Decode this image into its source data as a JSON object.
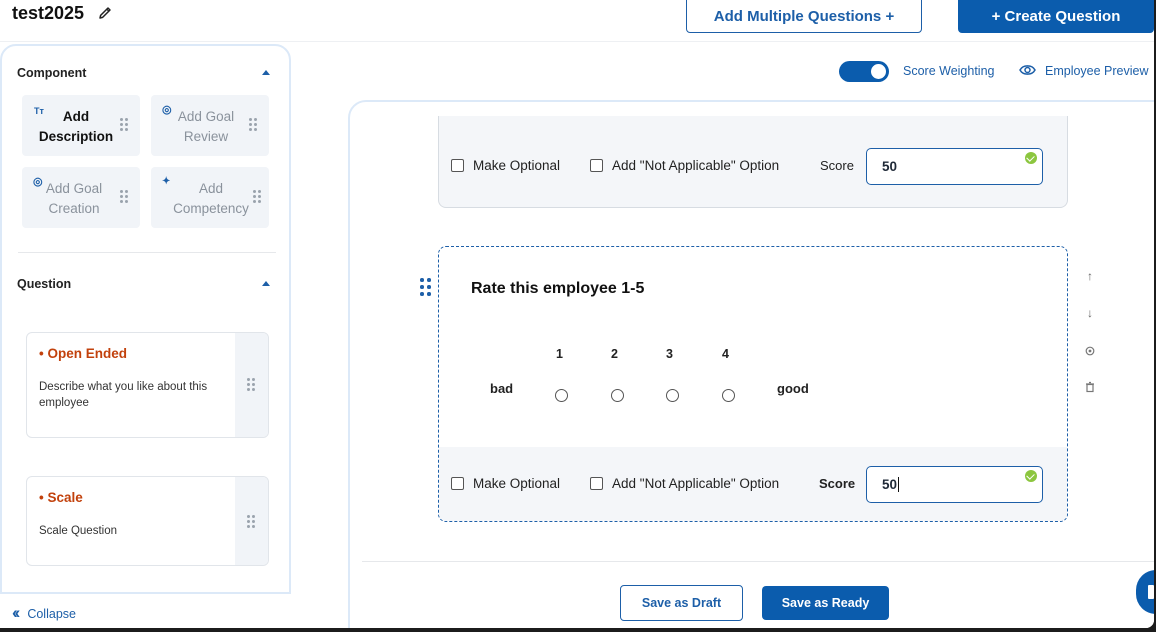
{
  "header": {
    "form_title": "test2025",
    "add_multiple_label": "Add Multiple Questions +",
    "create_question_label": "+ Create Question"
  },
  "sidebar": {
    "component_heading": "Component",
    "components": [
      {
        "label": "Add Description",
        "icon": "text-format-icon",
        "glyph": "Tт",
        "enabled": true
      },
      {
        "label": "Add Goal Review",
        "icon": "target-icon",
        "glyph": "◎",
        "enabled": false
      },
      {
        "label": "Add Goal Creation",
        "icon": "target-icon",
        "glyph": "◎",
        "enabled": false
      },
      {
        "label": "Add Competency",
        "icon": "sparkle-icon",
        "glyph": "✦",
        "enabled": false
      }
    ],
    "question_heading": "Question",
    "questions": [
      {
        "title": "• Open Ended",
        "description": "Describe what you like about this employee"
      },
      {
        "title": "• Scale",
        "description": "Scale Question"
      }
    ],
    "collapse_label": "Collapse"
  },
  "toolbar": {
    "score_weighting_label": "Score Weighting",
    "score_weighting_on": true,
    "employee_preview_label": "Employee Preview"
  },
  "builder": {
    "prev_question": {
      "make_optional_label": "Make Optional",
      "not_applicable_label": "Add \"Not Applicable\" Option",
      "score_label": "Score",
      "score_value": "50"
    },
    "current_question": {
      "title": "Rate this employee 1-5",
      "low_label": "bad",
      "high_label": "good",
      "scale_points": [
        "1",
        "2",
        "3",
        "4"
      ],
      "make_optional_label": "Make Optional",
      "not_applicable_label": "Add \"Not Applicable\" Option",
      "score_label": "Score",
      "score_value": "50"
    }
  },
  "footer": {
    "save_draft_label": "Save as Draft",
    "save_ready_label": "Save as Ready"
  },
  "colors": {
    "primary": "#0b5cad",
    "question_title": "#c2410c",
    "valid_check": "#8cc63f"
  }
}
